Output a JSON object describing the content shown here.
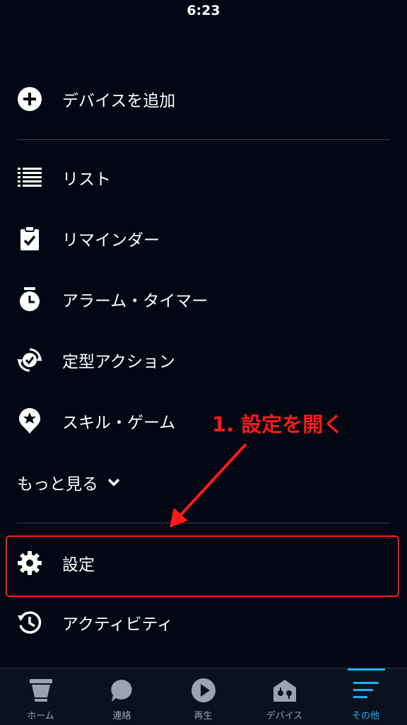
{
  "status_bar": {
    "time": "6:23"
  },
  "menu": {
    "add_device": {
      "label": "デバイスを追加",
      "icon": "plus-circle-icon"
    },
    "items": [
      {
        "label": "リスト",
        "icon": "list-icon"
      },
      {
        "label": "リマインダー",
        "icon": "clipboard-check-icon"
      },
      {
        "label": "アラーム・タイマー",
        "icon": "alarm-clock-icon"
      },
      {
        "label": "定型アクション",
        "icon": "routine-icon"
      },
      {
        "label": "スキル・ゲーム",
        "icon": "skill-icon"
      }
    ],
    "more": {
      "label": "もっと見る",
      "icon": "chevron-down-icon"
    },
    "settings": {
      "label": "設定",
      "icon": "gear-icon"
    },
    "activity": {
      "label": "アクティビティ",
      "icon": "history-icon"
    }
  },
  "annotation": {
    "text": "1. 設定を開く",
    "color": "#ff1a1a"
  },
  "tabbar": {
    "active_color": "#1ab3f5",
    "tabs": [
      {
        "label": "ホーム",
        "icon": "home-icon"
      },
      {
        "label": "連絡",
        "icon": "chat-icon"
      },
      {
        "label": "再生",
        "icon": "play-icon"
      },
      {
        "label": "デバイス",
        "icon": "devices-icon"
      },
      {
        "label": "その他",
        "icon": "menu-icon"
      }
    ]
  }
}
